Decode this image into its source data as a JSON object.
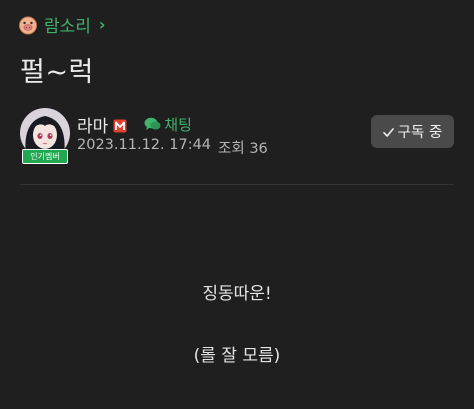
{
  "board": {
    "name": "람소리",
    "chevron": "›",
    "icon": "pig-face-icon",
    "accent_color": "#3fb26b"
  },
  "post": {
    "title": "펄~럭",
    "body_lines": [
      "징동따운!",
      "(롤 잘 모름)"
    ]
  },
  "author": {
    "name": "라마",
    "badge": "인기멤버",
    "manager_icon": "manager-m-icon",
    "avatar_icon": "anime-girl-avatar"
  },
  "chat": {
    "label": "채팅",
    "icon": "chat-bubbles-icon"
  },
  "meta": {
    "datetime": "2023.11.12. 17:44",
    "views_label": "조회 36"
  },
  "subscribe": {
    "label": "구독 중",
    "icon": "check-icon"
  }
}
